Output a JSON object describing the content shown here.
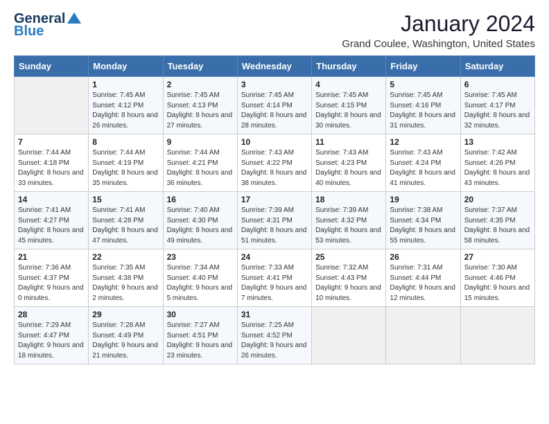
{
  "logo": {
    "line1": "General",
    "line2": "Blue"
  },
  "title": "January 2024",
  "location": "Grand Coulee, Washington, United States",
  "days_of_week": [
    "Sunday",
    "Monday",
    "Tuesday",
    "Wednesday",
    "Thursday",
    "Friday",
    "Saturday"
  ],
  "weeks": [
    [
      {
        "day": "",
        "sunrise": "",
        "sunset": "",
        "daylight": ""
      },
      {
        "day": "1",
        "sunrise": "Sunrise: 7:45 AM",
        "sunset": "Sunset: 4:12 PM",
        "daylight": "Daylight: 8 hours and 26 minutes."
      },
      {
        "day": "2",
        "sunrise": "Sunrise: 7:45 AM",
        "sunset": "Sunset: 4:13 PM",
        "daylight": "Daylight: 8 hours and 27 minutes."
      },
      {
        "day": "3",
        "sunrise": "Sunrise: 7:45 AM",
        "sunset": "Sunset: 4:14 PM",
        "daylight": "Daylight: 8 hours and 28 minutes."
      },
      {
        "day": "4",
        "sunrise": "Sunrise: 7:45 AM",
        "sunset": "Sunset: 4:15 PM",
        "daylight": "Daylight: 8 hours and 30 minutes."
      },
      {
        "day": "5",
        "sunrise": "Sunrise: 7:45 AM",
        "sunset": "Sunset: 4:16 PM",
        "daylight": "Daylight: 8 hours and 31 minutes."
      },
      {
        "day": "6",
        "sunrise": "Sunrise: 7:45 AM",
        "sunset": "Sunset: 4:17 PM",
        "daylight": "Daylight: 8 hours and 32 minutes."
      }
    ],
    [
      {
        "day": "7",
        "sunrise": "Sunrise: 7:44 AM",
        "sunset": "Sunset: 4:18 PM",
        "daylight": "Daylight: 8 hours and 33 minutes."
      },
      {
        "day": "8",
        "sunrise": "Sunrise: 7:44 AM",
        "sunset": "Sunset: 4:19 PM",
        "daylight": "Daylight: 8 hours and 35 minutes."
      },
      {
        "day": "9",
        "sunrise": "Sunrise: 7:44 AM",
        "sunset": "Sunset: 4:21 PM",
        "daylight": "Daylight: 8 hours and 36 minutes."
      },
      {
        "day": "10",
        "sunrise": "Sunrise: 7:43 AM",
        "sunset": "Sunset: 4:22 PM",
        "daylight": "Daylight: 8 hours and 38 minutes."
      },
      {
        "day": "11",
        "sunrise": "Sunrise: 7:43 AM",
        "sunset": "Sunset: 4:23 PM",
        "daylight": "Daylight: 8 hours and 40 minutes."
      },
      {
        "day": "12",
        "sunrise": "Sunrise: 7:43 AM",
        "sunset": "Sunset: 4:24 PM",
        "daylight": "Daylight: 8 hours and 41 minutes."
      },
      {
        "day": "13",
        "sunrise": "Sunrise: 7:42 AM",
        "sunset": "Sunset: 4:26 PM",
        "daylight": "Daylight: 8 hours and 43 minutes."
      }
    ],
    [
      {
        "day": "14",
        "sunrise": "Sunrise: 7:41 AM",
        "sunset": "Sunset: 4:27 PM",
        "daylight": "Daylight: 8 hours and 45 minutes."
      },
      {
        "day": "15",
        "sunrise": "Sunrise: 7:41 AM",
        "sunset": "Sunset: 4:28 PM",
        "daylight": "Daylight: 8 hours and 47 minutes."
      },
      {
        "day": "16",
        "sunrise": "Sunrise: 7:40 AM",
        "sunset": "Sunset: 4:30 PM",
        "daylight": "Daylight: 8 hours and 49 minutes."
      },
      {
        "day": "17",
        "sunrise": "Sunrise: 7:39 AM",
        "sunset": "Sunset: 4:31 PM",
        "daylight": "Daylight: 8 hours and 51 minutes."
      },
      {
        "day": "18",
        "sunrise": "Sunrise: 7:39 AM",
        "sunset": "Sunset: 4:32 PM",
        "daylight": "Daylight: 8 hours and 53 minutes."
      },
      {
        "day": "19",
        "sunrise": "Sunrise: 7:38 AM",
        "sunset": "Sunset: 4:34 PM",
        "daylight": "Daylight: 8 hours and 55 minutes."
      },
      {
        "day": "20",
        "sunrise": "Sunrise: 7:37 AM",
        "sunset": "Sunset: 4:35 PM",
        "daylight": "Daylight: 8 hours and 58 minutes."
      }
    ],
    [
      {
        "day": "21",
        "sunrise": "Sunrise: 7:36 AM",
        "sunset": "Sunset: 4:37 PM",
        "daylight": "Daylight: 9 hours and 0 minutes."
      },
      {
        "day": "22",
        "sunrise": "Sunrise: 7:35 AM",
        "sunset": "Sunset: 4:38 PM",
        "daylight": "Daylight: 9 hours and 2 minutes."
      },
      {
        "day": "23",
        "sunrise": "Sunrise: 7:34 AM",
        "sunset": "Sunset: 4:40 PM",
        "daylight": "Daylight: 9 hours and 5 minutes."
      },
      {
        "day": "24",
        "sunrise": "Sunrise: 7:33 AM",
        "sunset": "Sunset: 4:41 PM",
        "daylight": "Daylight: 9 hours and 7 minutes."
      },
      {
        "day": "25",
        "sunrise": "Sunrise: 7:32 AM",
        "sunset": "Sunset: 4:43 PM",
        "daylight": "Daylight: 9 hours and 10 minutes."
      },
      {
        "day": "26",
        "sunrise": "Sunrise: 7:31 AM",
        "sunset": "Sunset: 4:44 PM",
        "daylight": "Daylight: 9 hours and 12 minutes."
      },
      {
        "day": "27",
        "sunrise": "Sunrise: 7:30 AM",
        "sunset": "Sunset: 4:46 PM",
        "daylight": "Daylight: 9 hours and 15 minutes."
      }
    ],
    [
      {
        "day": "28",
        "sunrise": "Sunrise: 7:29 AM",
        "sunset": "Sunset: 4:47 PM",
        "daylight": "Daylight: 9 hours and 18 minutes."
      },
      {
        "day": "29",
        "sunrise": "Sunrise: 7:28 AM",
        "sunset": "Sunset: 4:49 PM",
        "daylight": "Daylight: 9 hours and 21 minutes."
      },
      {
        "day": "30",
        "sunrise": "Sunrise: 7:27 AM",
        "sunset": "Sunset: 4:51 PM",
        "daylight": "Daylight: 9 hours and 23 minutes."
      },
      {
        "day": "31",
        "sunrise": "Sunrise: 7:25 AM",
        "sunset": "Sunset: 4:52 PM",
        "daylight": "Daylight: 9 hours and 26 minutes."
      },
      {
        "day": "",
        "sunrise": "",
        "sunset": "",
        "daylight": ""
      },
      {
        "day": "",
        "sunrise": "",
        "sunset": "",
        "daylight": ""
      },
      {
        "day": "",
        "sunrise": "",
        "sunset": "",
        "daylight": ""
      }
    ]
  ]
}
